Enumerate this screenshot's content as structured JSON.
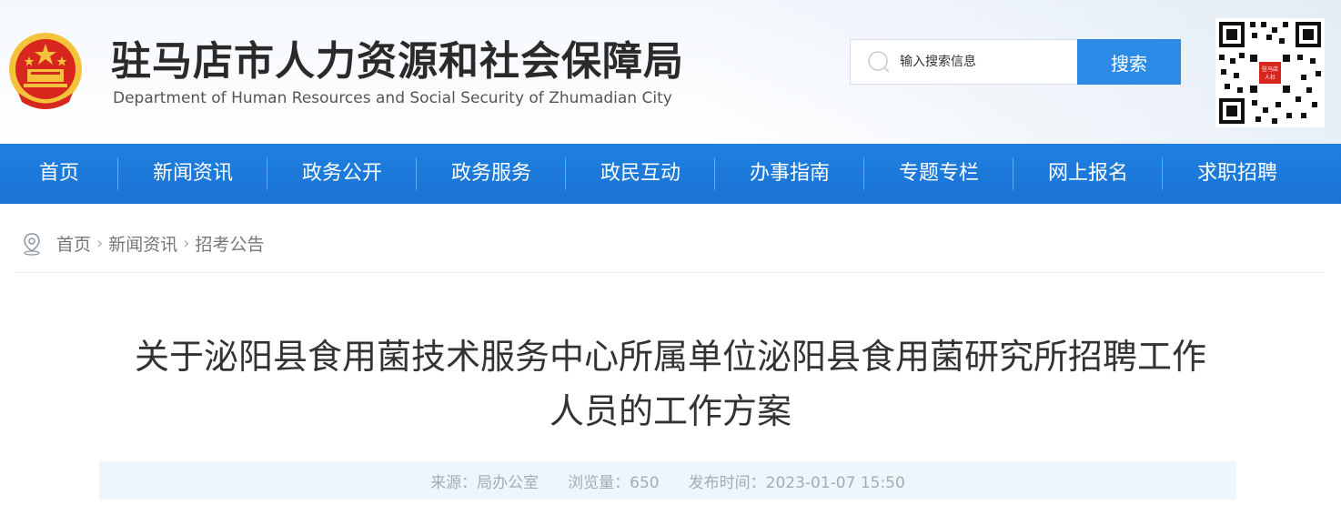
{
  "header": {
    "title": "驻马店市人力资源和社会保障局",
    "subtitle": "Department of Human Resources and Social Security of Zhumadian City",
    "search_placeholder": "输入搜索信息",
    "search_button": "搜索",
    "qr_center_label": "驻马店人社"
  },
  "nav": {
    "items": [
      {
        "label": "首页"
      },
      {
        "label": "新闻资讯"
      },
      {
        "label": "政务公开"
      },
      {
        "label": "政务服务"
      },
      {
        "label": "政民互动"
      },
      {
        "label": "办事指南"
      },
      {
        "label": "专题专栏"
      },
      {
        "label": "网上报名"
      },
      {
        "label": "求职招聘"
      }
    ]
  },
  "breadcrumb": {
    "items": [
      {
        "label": "首页"
      },
      {
        "label": "新闻资讯"
      },
      {
        "label": "招考公告"
      }
    ],
    "separator": "›"
  },
  "article": {
    "title_line1": "关于泌阳县食用菌技术服务中心所属单位泌阳县食用菌研究所招聘工作",
    "title_line2": "人员的工作方案",
    "meta": {
      "source": "来源：局办公室",
      "views": "浏览量：650",
      "published": "发布时间：2023-01-07 15:50"
    }
  },
  "colors": {
    "nav_bg": "#1f7fe0",
    "search_button_bg": "#2b8be6",
    "meta_bg": "#eef6fc",
    "emblem_red": "#d7261e",
    "emblem_gold": "#f5c33b"
  },
  "icons": {
    "emblem": "national-emblem",
    "search": "search-icon",
    "location": "location-pin-icon",
    "qr": "qr-code"
  }
}
